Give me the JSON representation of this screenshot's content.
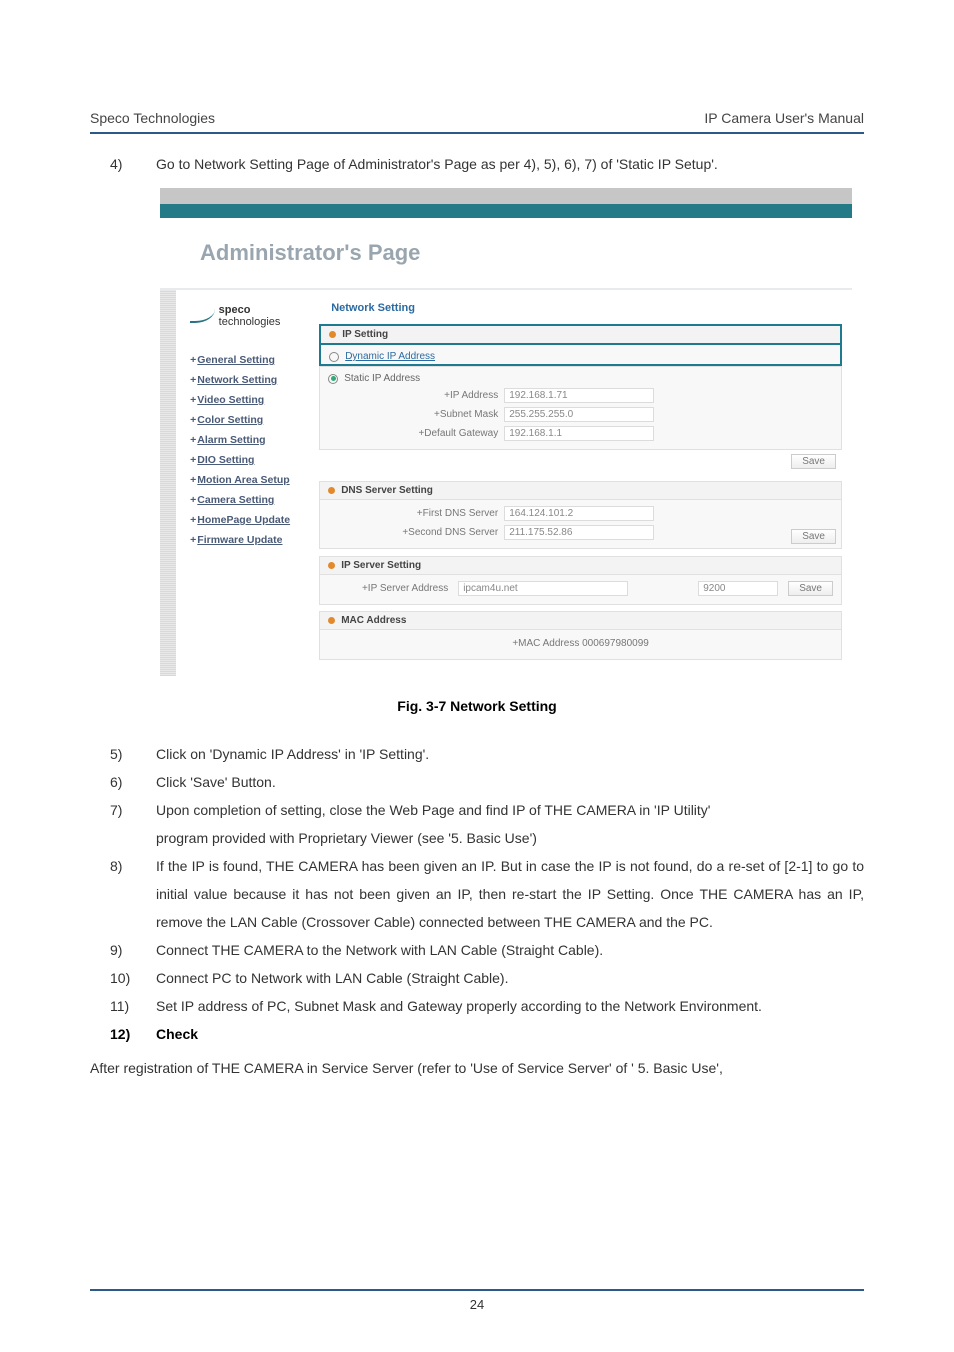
{
  "header": {
    "left": "Speco Technologies",
    "right": "IP Camera User's Manual"
  },
  "intro_step": {
    "num": "4)",
    "text": "Go to Network Setting Page of Administrator's Page as per 4), 5), 6), 7) of   'Static IP Setup'."
  },
  "admin": {
    "title": "Administrator's  Page",
    "section": "Network Setting",
    "logo": {
      "bold": "speco",
      "rest": " technologies"
    },
    "nav": [
      "General Setting",
      "Network Setting",
      "Video Setting",
      "Color Setting",
      "Alarm Setting",
      "DIO Setting",
      "Motion Area Setup",
      "Camera Setting",
      "HomePage Update",
      "Firmware Update"
    ],
    "ip_setting": {
      "title": "IP Setting",
      "dynamic": "Dynamic IP Address",
      "static": "Static IP Address",
      "fields": [
        {
          "label": "+IP Address",
          "value": "192.168.1.71"
        },
        {
          "label": "+Subnet Mask",
          "value": "255.255.255.0"
        },
        {
          "label": "+Default Gateway",
          "value": "192.168.1.1"
        }
      ],
      "save": "Save"
    },
    "dns": {
      "title": "DNS Server Setting",
      "fields": [
        {
          "label": "+First DNS Server",
          "value": "164.124.101.2"
        },
        {
          "label": "+Second DNS Server",
          "value": "211.175.52.86"
        }
      ],
      "save": "Save"
    },
    "ipserver": {
      "title": "IP Server Setting",
      "label": "+IP Server Address",
      "host": "ipcam4u.net",
      "port": "9200",
      "save": "Save"
    },
    "mac": {
      "title": "MAC Address",
      "label": "+MAC Address",
      "value": "000697980099"
    }
  },
  "caption": "Fig. 3-7   Network Setting",
  "steps": [
    {
      "num": "5)",
      "text": "Click on 'Dynamic IP Address' in 'IP Setting'."
    },
    {
      "num": "6)",
      "text": "Click 'Save' Button."
    },
    {
      "num": "7)",
      "text": "Upon completion of setting, close the Web Page and find IP of THE CAMERA in 'IP Utility'"
    },
    {
      "num": "",
      "text": " program provided with Proprietary Viewer (see '5. Basic Use')",
      "inner": true
    },
    {
      "num": "8)",
      "text": "If the IP is found, THE CAMERA has been given an IP. But in case the IP is not found, do a re-set   of [2-1] to go to initial value because it has not been given an IP, then re-start the IP Setting. Once THE CAMERA has an IP, remove the LAN Cable (Crossover Cable) connected between THE CAMERA and the PC."
    },
    {
      "num": "9)",
      "text": "Connect THE CAMERA to the Network with LAN Cable (Straight Cable)."
    },
    {
      "num": "10)",
      "text": "Connect PC to Network with LAN Cable (Straight Cable)."
    },
    {
      "num": "11)",
      "text": "Set IP address of PC, Subnet Mask and Gateway properly according to the Network Environment."
    }
  ],
  "check": {
    "num": "12)",
    "label": "Check"
  },
  "after": "After registration of THE CAMERA in Service Server (refer to 'Use of Service Server' of ' 5. Basic Use',",
  "page_number": "24"
}
